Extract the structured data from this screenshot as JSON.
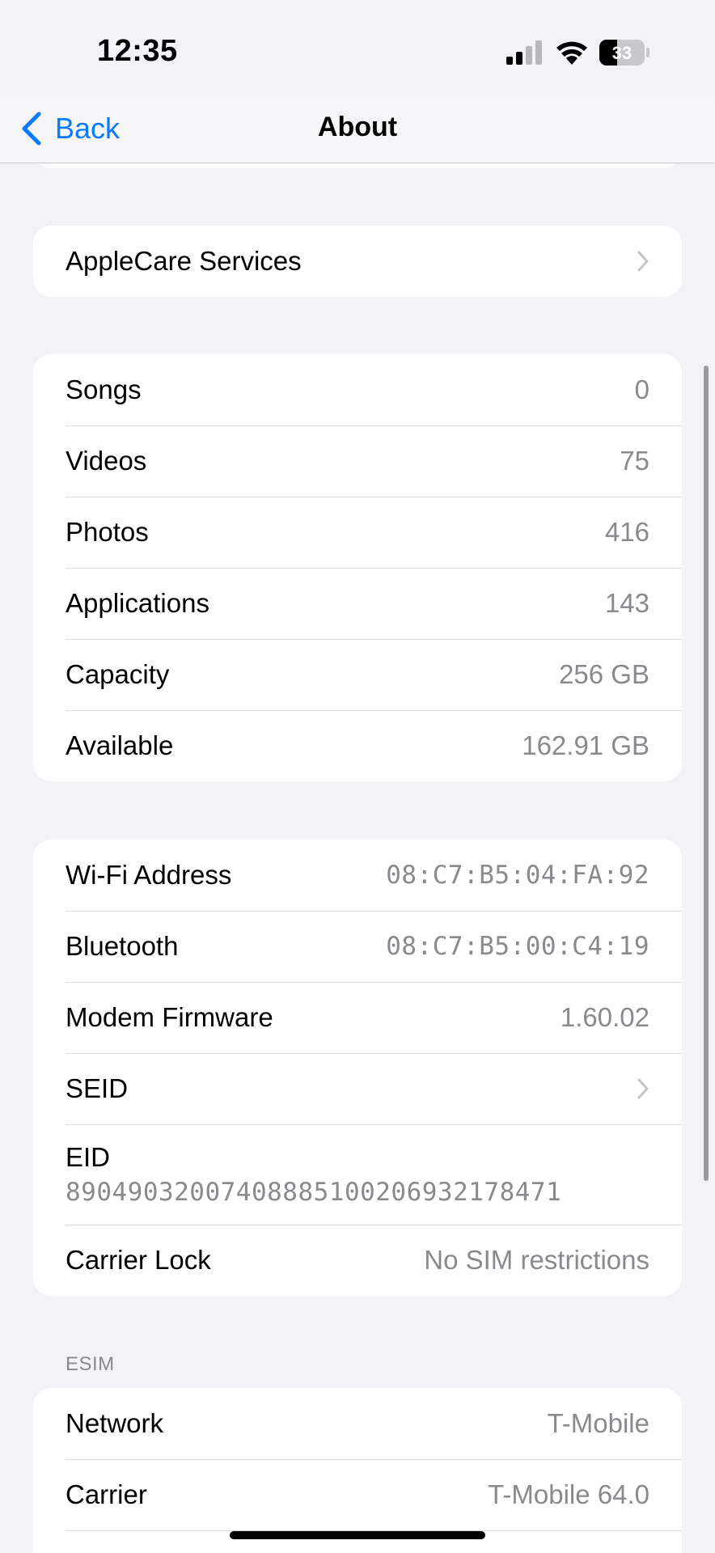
{
  "status_bar": {
    "time": "12:35",
    "battery_level": "33",
    "signal_icon": "cellular-signal-icon",
    "wifi_icon": "wifi-icon",
    "battery_icon": "battery-icon"
  },
  "nav": {
    "back_label": "Back",
    "title": "About"
  },
  "applecare": {
    "label": "AppleCare Services"
  },
  "media": [
    {
      "label": "Songs",
      "value": "0"
    },
    {
      "label": "Videos",
      "value": "75"
    },
    {
      "label": "Photos",
      "value": "416"
    },
    {
      "label": "Applications",
      "value": "143"
    },
    {
      "label": "Capacity",
      "value": "256 GB"
    },
    {
      "label": "Available",
      "value": "162.91 GB"
    }
  ],
  "network_info": {
    "wifi_address": {
      "label": "Wi-Fi Address",
      "value": "08:C7:B5:04:FA:92"
    },
    "bluetooth": {
      "label": "Bluetooth",
      "value": "08:C7:B5:00:C4:19"
    },
    "modem_firmware": {
      "label": "Modem Firmware",
      "value": "1.60.02"
    },
    "seid": {
      "label": "SEID"
    },
    "eid": {
      "label": "EID",
      "value": "89049032007408885100206932178471"
    },
    "carrier_lock": {
      "label": "Carrier Lock",
      "value": "No SIM restrictions"
    }
  },
  "esim": {
    "header": "ESIM",
    "network": {
      "label": "Network",
      "value": "T-Mobile"
    },
    "carrier": {
      "label": "Carrier",
      "value": "T-Mobile 64.0"
    }
  },
  "colors": {
    "accent": "#0a7aff",
    "background": "#f2f2f7",
    "secondary_text": "#8a8a8e"
  }
}
